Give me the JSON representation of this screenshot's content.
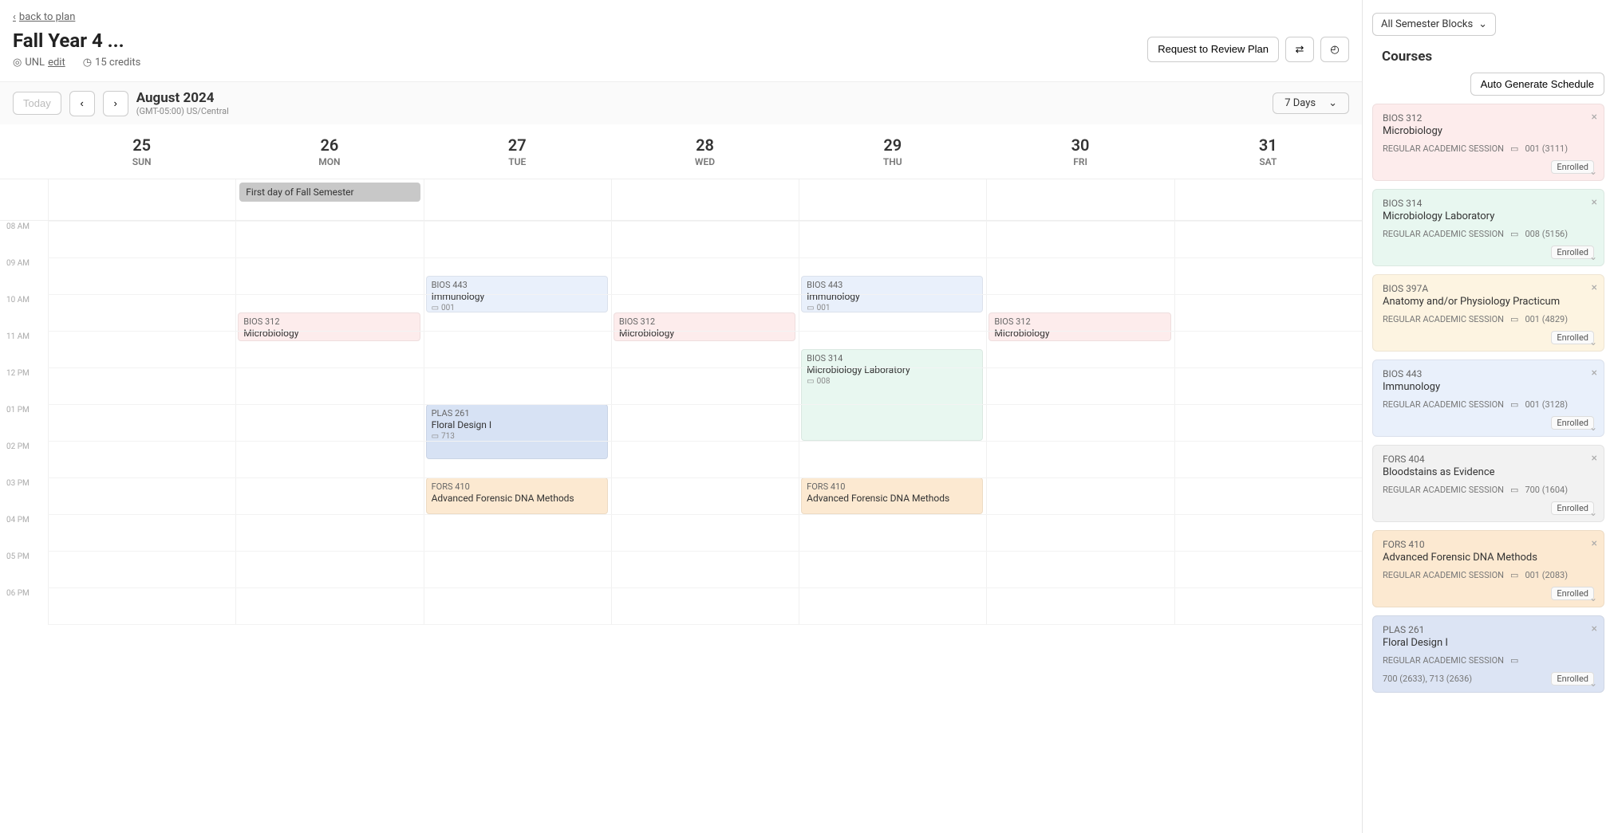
{
  "header": {
    "back_label": "back to plan",
    "title": "Fall Year 4 ...",
    "institution": "UNL",
    "edit_label": "edit",
    "credits": "15 credits",
    "request_review": "Request to Review Plan"
  },
  "calendar": {
    "today_label": "Today",
    "month_label": "August 2024",
    "timezone": "(GMT-05:00) US/Central",
    "range_label": "7 Days",
    "days": [
      {
        "num": "25",
        "name": "SUN"
      },
      {
        "num": "26",
        "name": "MON"
      },
      {
        "num": "27",
        "name": "TUE"
      },
      {
        "num": "28",
        "name": "WED"
      },
      {
        "num": "29",
        "name": "THU"
      },
      {
        "num": "30",
        "name": "FRI"
      },
      {
        "num": "31",
        "name": "SAT"
      }
    ],
    "time_labels": [
      "08 AM",
      "09 AM",
      "10 AM",
      "11 AM",
      "12 PM",
      "01 PM",
      "02 PM",
      "03 PM",
      "04 PM",
      "05 PM",
      "06 PM"
    ],
    "allday": [
      {
        "day": 1,
        "text": "First day of Fall Semester"
      }
    ],
    "events": [
      {
        "day": 1,
        "start": 10.5,
        "end": 11.0,
        "color": "c-pink",
        "code": "BIOS 312",
        "name": "Microbiology",
        "section": ""
      },
      {
        "day": 2,
        "start": 9.5,
        "end": 10.5,
        "color": "c-blue-l",
        "code": "BIOS 443",
        "name": "Immunology",
        "section": "001"
      },
      {
        "day": 2,
        "start": 13.0,
        "end": 14.5,
        "color": "c-blue",
        "code": "PLAS 261",
        "name": "Floral Design I",
        "section": "713"
      },
      {
        "day": 2,
        "start": 15.0,
        "end": 16.0,
        "color": "c-orange",
        "code": "FORS 410",
        "name": "Advanced Forensic DNA Methods",
        "section": ""
      },
      {
        "day": 3,
        "start": 10.5,
        "end": 11.0,
        "color": "c-pink",
        "code": "BIOS 312",
        "name": "Microbiology",
        "section": ""
      },
      {
        "day": 4,
        "start": 9.5,
        "end": 10.5,
        "color": "c-blue-l",
        "code": "BIOS 443",
        "name": "Immunology",
        "section": "001"
      },
      {
        "day": 4,
        "start": 11.5,
        "end": 14.0,
        "color": "c-green",
        "code": "BIOS 314",
        "name": "Microbiology Laboratory",
        "section": "008"
      },
      {
        "day": 4,
        "start": 15.0,
        "end": 16.0,
        "color": "c-orange",
        "code": "FORS 410",
        "name": "Advanced Forensic DNA Methods",
        "section": ""
      },
      {
        "day": 5,
        "start": 10.5,
        "end": 11.0,
        "color": "c-pink",
        "code": "BIOS 312",
        "name": "Microbiology",
        "section": ""
      }
    ]
  },
  "sidebar": {
    "filter_label": "All Semester Blocks",
    "courses_title": "Courses",
    "generate_label": "Auto Generate Schedule",
    "courses": [
      {
        "code": "BIOS 312",
        "name": "Microbiology",
        "session": "REGULAR ACADEMIC SESSION",
        "section": "001 (3111)",
        "status": "Enrolled",
        "color": "cc-pink"
      },
      {
        "code": "BIOS 314",
        "name": "Microbiology Laboratory",
        "session": "REGULAR ACADEMIC SESSION",
        "section": "008 (5156)",
        "status": "Enrolled",
        "color": "cc-green"
      },
      {
        "code": "BIOS 397A",
        "name": "Anatomy and/or Physiology Practicum",
        "session": "REGULAR ACADEMIC SESSION",
        "section": "001 (4829)",
        "status": "Enrolled",
        "color": "cc-yellow"
      },
      {
        "code": "BIOS 443",
        "name": "Immunology",
        "session": "REGULAR ACADEMIC SESSION",
        "section": "001 (3128)",
        "status": "Enrolled",
        "color": "cc-blue-l"
      },
      {
        "code": "FORS 404",
        "name": "Bloodstains as Evidence",
        "session": "REGULAR ACADEMIC SESSION",
        "section": "700 (1604)",
        "status": "Enrolled",
        "color": "cc-gray"
      },
      {
        "code": "FORS 410",
        "name": "Advanced Forensic DNA Methods",
        "session": "REGULAR ACADEMIC SESSION",
        "section": "001 (2083)",
        "status": "Enrolled",
        "color": "cc-orange"
      },
      {
        "code": "PLAS 261",
        "name": "Floral Design I",
        "session": "REGULAR ACADEMIC SESSION",
        "section": "700 (2633),  713 (2636)",
        "status": "Enrolled",
        "color": "cc-blue"
      }
    ]
  }
}
